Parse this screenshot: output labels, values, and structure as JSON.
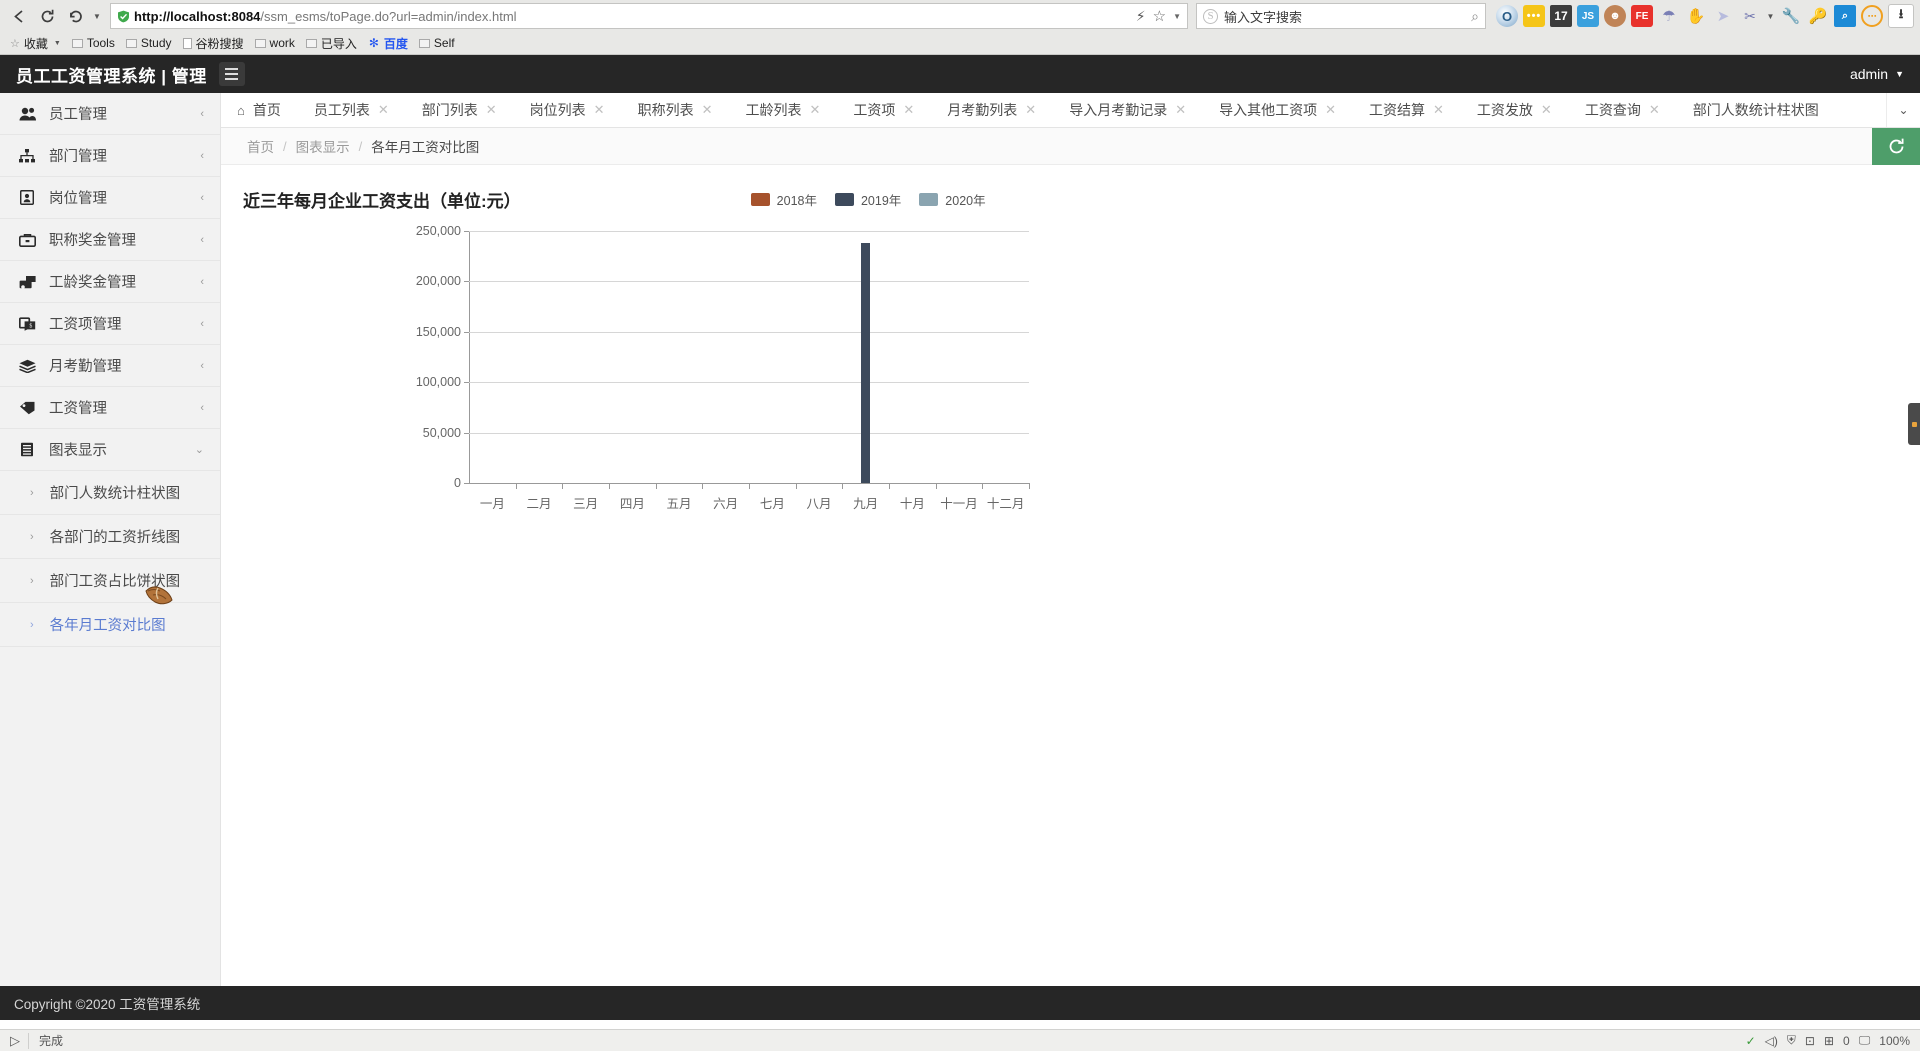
{
  "browser": {
    "back_icon": "back-arrow-icon",
    "reload_icon": "reload-icon",
    "history_icon": "history-undo-icon",
    "url": "http://localhost:8084/ssm_esms/toPage.do?url=admin/index.html",
    "url_host": "http://localhost:8084",
    "url_path": "/ssm_esms/toPage.do?url=admin/index.html",
    "search_placeholder": "输入文字搜索",
    "bookmarks": [
      {
        "label": "收藏",
        "icon": "star-icon"
      },
      {
        "label": "Tools",
        "icon": "folder-icon"
      },
      {
        "label": "Study",
        "icon": "folder-icon"
      },
      {
        "label": "谷粉搜搜",
        "icon": "page-icon"
      },
      {
        "label": "work",
        "icon": "folder-icon"
      },
      {
        "label": "已导入",
        "icon": "folder-icon"
      },
      {
        "label": "百度",
        "icon": "baidu-icon"
      },
      {
        "label": "Self",
        "icon": "folder-icon"
      }
    ],
    "extensions": [
      {
        "name": "opera-icon",
        "glyph": "O"
      },
      {
        "name": "dots-badge-icon",
        "glyph": "•••"
      },
      {
        "name": "counter-badge-icon",
        "glyph": "17"
      },
      {
        "name": "js-icon",
        "glyph": "JS"
      },
      {
        "name": "monkey-icon",
        "glyph": "☺"
      },
      {
        "name": "firebug-icon",
        "glyph": "FE"
      },
      {
        "name": "parachute-icon",
        "glyph": "☂"
      },
      {
        "name": "hand-icon",
        "glyph": "✋"
      },
      {
        "name": "pointer-icon",
        "glyph": "➤"
      },
      {
        "name": "scissors-icon",
        "glyph": "✂"
      },
      {
        "name": "wrench-icon",
        "glyph": "🔧"
      },
      {
        "name": "key-icon",
        "glyph": "🔑"
      },
      {
        "name": "search-page-icon",
        "glyph": "⌕"
      },
      {
        "name": "more-circle-icon",
        "glyph": "⋯"
      },
      {
        "name": "download-icon",
        "glyph": "⬇"
      }
    ]
  },
  "header": {
    "title": "员工工资管理系统 | 管理",
    "menu_toggle_icon": "hamburger-icon",
    "user": "admin",
    "user_caret": "▼"
  },
  "sidebar": {
    "items": [
      {
        "label": "员工管理",
        "icon": "users-icon",
        "arrow": "‹"
      },
      {
        "label": "部门管理",
        "icon": "sitemap-icon",
        "arrow": "‹"
      },
      {
        "label": "岗位管理",
        "icon": "badge-icon",
        "arrow": "‹"
      },
      {
        "label": "职称奖金管理",
        "icon": "briefcase-icon",
        "arrow": "‹"
      },
      {
        "label": "工龄奖金管理",
        "icon": "money-icon",
        "arrow": "‹"
      },
      {
        "label": "工资项管理",
        "icon": "bill-icon",
        "arrow": "‹"
      },
      {
        "label": "月考勤管理",
        "icon": "layers-icon",
        "arrow": "‹"
      },
      {
        "label": "工资管理",
        "icon": "tag-icon",
        "arrow": "‹"
      },
      {
        "label": "图表显示",
        "icon": "chart-list-icon",
        "arrow": "⌄"
      }
    ],
    "subitems": [
      {
        "label": "部门人数统计柱状图",
        "arrow": "›",
        "active": false
      },
      {
        "label": "各部门的工资折线图",
        "arrow": "›",
        "active": false
      },
      {
        "label": "部门工资占比饼状图",
        "arrow": "›",
        "active": false
      },
      {
        "label": "各年月工资对比图",
        "arrow": "›",
        "active": true
      }
    ]
  },
  "tabs": {
    "home": {
      "label": "首页",
      "icon": "home-icon"
    },
    "items": [
      {
        "label": "员工列表"
      },
      {
        "label": "部门列表"
      },
      {
        "label": "岗位列表"
      },
      {
        "label": "职称列表"
      },
      {
        "label": "工龄列表"
      },
      {
        "label": "工资项"
      },
      {
        "label": "月考勤列表"
      },
      {
        "label": "导入月考勤记录"
      },
      {
        "label": "导入其他工资项"
      },
      {
        "label": "工资结算"
      },
      {
        "label": "工资发放"
      },
      {
        "label": "工资查询"
      }
    ],
    "last": {
      "label": "部门人数统计柱状图"
    },
    "close_glyph": "✕",
    "more_icon": "chevron-down-icon"
  },
  "breadcrumb": {
    "items": [
      "首页",
      "图表显示",
      "各年月工资对比图"
    ],
    "separator": "/",
    "refresh_icon": "refresh-icon"
  },
  "chart_data": {
    "type": "bar",
    "title": "近三年每月企业工资支出（单位:元）",
    "xlabel": "",
    "ylabel": "",
    "ylim": [
      0,
      250000
    ],
    "yticks": [
      0,
      50000,
      100000,
      150000,
      200000,
      250000
    ],
    "ytick_labels": [
      "0",
      "50,000",
      "100,000",
      "150,000",
      "200,000",
      "250,000"
    ],
    "grid": true,
    "legend_position": "top-center",
    "categories": [
      "一月",
      "二月",
      "三月",
      "四月",
      "五月",
      "六月",
      "七月",
      "八月",
      "九月",
      "十月",
      "十一月",
      "十二月"
    ],
    "series": [
      {
        "name": "2018年",
        "color": "#a6522c",
        "values": [
          0,
          0,
          0,
          0,
          0,
          0,
          0,
          0,
          0,
          0,
          0,
          0
        ]
      },
      {
        "name": "2019年",
        "color": "#3d4a5c",
        "values": [
          0,
          0,
          0,
          0,
          0,
          0,
          0,
          0,
          238000,
          0,
          0,
          0
        ]
      },
      {
        "name": "2020年",
        "color": "#8aa4b0",
        "values": [
          0,
          0,
          0,
          0,
          0,
          0,
          0,
          0,
          0,
          0,
          0,
          0
        ]
      }
    ]
  },
  "footer": {
    "text": "Copyright ©2020 工资管理系统"
  },
  "statusbar": {
    "play_icon": "play-icon",
    "status_text": "完成",
    "zoom": "100%",
    "counters": "0",
    "icons": [
      "check-icon",
      "speaker-icon",
      "shield-icon",
      "lock-icon",
      "window-icon",
      "monitor-icon"
    ]
  }
}
